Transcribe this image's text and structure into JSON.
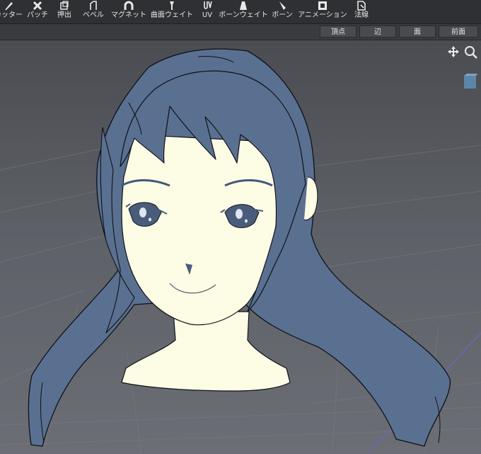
{
  "toolbar": {
    "items": [
      {
        "label": "カッター",
        "icon": "cutter-icon"
      },
      {
        "label": "パッチ",
        "icon": "patch-icon"
      },
      {
        "label": "押出",
        "icon": "extrude-icon"
      },
      {
        "label": "ベベル",
        "icon": "bevel-icon"
      },
      {
        "label": "マグネット",
        "icon": "magnet-icon"
      },
      {
        "label": "曲面ウェイト",
        "icon": "surface-weight-icon"
      },
      {
        "label": "UV",
        "icon": "uv-icon"
      },
      {
        "label": "ボーンウェイト",
        "icon": "bone-weight-icon"
      },
      {
        "label": "ボーン",
        "icon": "bone-icon"
      },
      {
        "label": "アニメーション",
        "icon": "animation-icon"
      },
      {
        "label": "法線",
        "icon": "normal-icon"
      }
    ]
  },
  "selection_modes": {
    "vertex": "頂点",
    "edge": "辺",
    "face": "面",
    "front_face": "前面"
  },
  "viewport": {
    "background": "#5f6168",
    "hair_color": "#5a7090",
    "skin_color": "#fdfde6",
    "outline_color": "#0e1118",
    "nav_icons": [
      "move-icon",
      "zoom-icon"
    ]
  }
}
